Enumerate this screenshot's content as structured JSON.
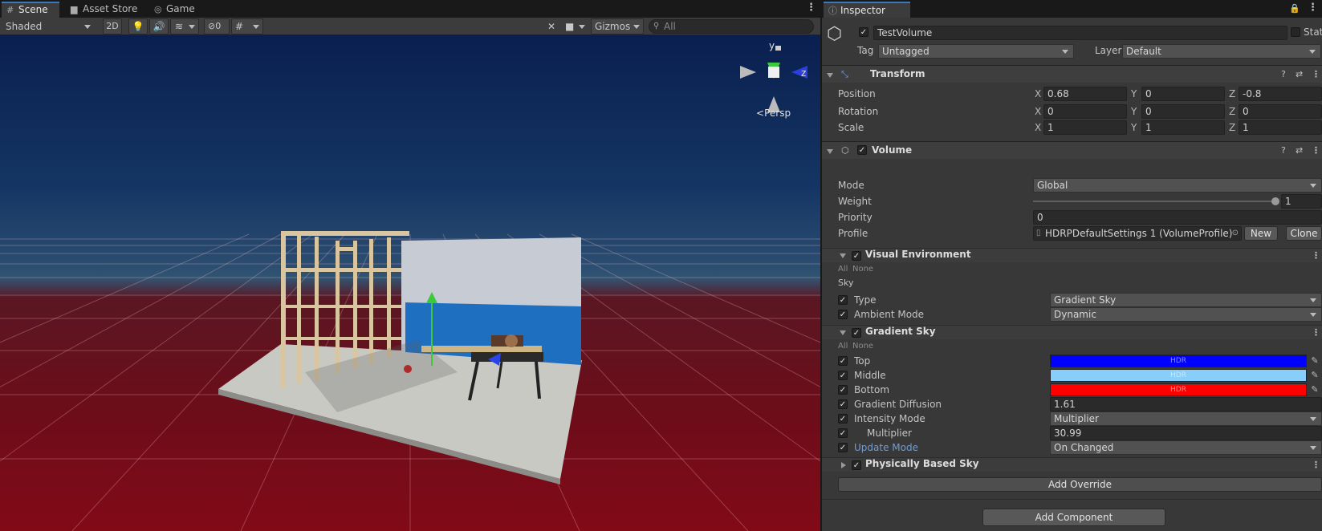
{
  "scene_tabs": [
    {
      "label": "Scene",
      "icon": "grid-icon"
    },
    {
      "label": "Asset Store",
      "icon": "bag-icon"
    },
    {
      "label": "Game",
      "icon": "gamepad-icon"
    }
  ],
  "scene_toolbar": {
    "shading_mode": "Shaded",
    "mode_2d": "2D",
    "hidden_count": "0",
    "gizmos_label": "Gizmos",
    "search_placeholder": "All"
  },
  "viewport": {
    "gizmo_y": "y",
    "gizmo_z": "z",
    "projection_label": "Persp"
  },
  "inspector": {
    "tab_label": "Inspector",
    "object_name": "TestVolume",
    "static_label": "Static",
    "tag_label": "Tag",
    "tag_value": "Untagged",
    "layer_label": "Layer",
    "layer_value": "Default",
    "transform": {
      "title": "Transform",
      "rows": [
        {
          "label": "Position",
          "x": "0.68",
          "y": "0",
          "z": "-0.8"
        },
        {
          "label": "Rotation",
          "x": "0",
          "y": "0",
          "z": "0"
        },
        {
          "label": "Scale",
          "x": "1",
          "y": "1",
          "z": "1"
        }
      ],
      "axis_x": "X",
      "axis_y": "Y",
      "axis_z": "Z"
    },
    "volume": {
      "title": "Volume",
      "mode_label": "Mode",
      "mode_value": "Global",
      "weight_label": "Weight",
      "weight_value": "1",
      "weight_fraction": 1.0,
      "priority_label": "Priority",
      "priority_value": "0",
      "profile_label": "Profile",
      "profile_value": "HDRPDefaultSettings 1 (VolumeProfile)",
      "new_label": "New",
      "clone_label": "Clone"
    },
    "visual_environment": {
      "title": "Visual Environment",
      "all_label": "All",
      "none_label": "None",
      "section_label": "Sky",
      "type_label": "Type",
      "type_value": "Gradient Sky",
      "ambient_label": "Ambient Mode",
      "ambient_value": "Dynamic"
    },
    "gradient_sky": {
      "title": "Gradient Sky",
      "all_label": "All",
      "none_label": "None",
      "top_label": "Top",
      "top_color": "#0000ff",
      "middle_label": "Middle",
      "middle_color": "#87cefa",
      "bottom_label": "Bottom",
      "bottom_color": "#ff0000",
      "hdr_label": "HDR",
      "diffusion_label": "Gradient Diffusion",
      "diffusion_value": "1.61",
      "intensity_label": "Intensity Mode",
      "intensity_value": "Multiplier",
      "multiplier_label": "Multiplier",
      "multiplier_value": "30.99",
      "update_label": "Update Mode",
      "update_value": "On Changed"
    },
    "physically_based_sky": {
      "title": "Physically Based Sky"
    },
    "add_override_label": "Add Override",
    "add_component_label": "Add Component"
  }
}
